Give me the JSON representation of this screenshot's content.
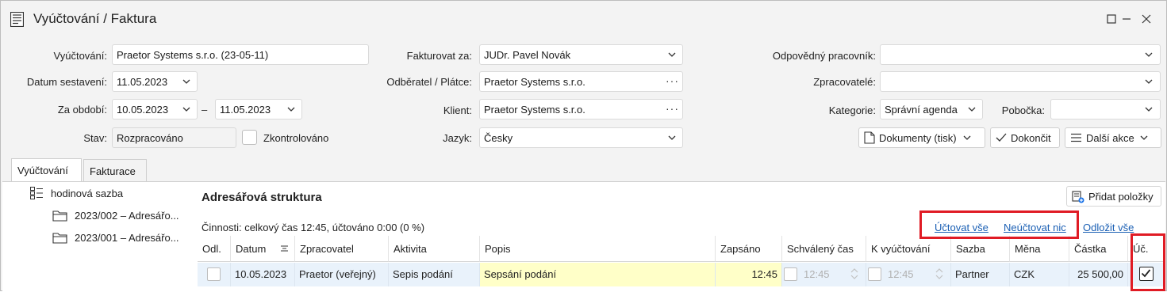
{
  "window": {
    "title": "Vyúčtování / Faktura",
    "controls": [
      "minimize-icon",
      "maximize-icon",
      "close-icon"
    ]
  },
  "form": {
    "vyuctovani_label": "Vyúčtování:",
    "vyuctovani_value": "Praetor Systems s.r.o. (23-05-11)",
    "datum_sestaveni_label": "Datum sestavení:",
    "datum_sestaveni_value": "11.05.2023",
    "za_obdobi_label": "Za období:",
    "za_obdobi_from": "10.05.2023",
    "za_obdobi_sep": "–",
    "za_obdobi_to": "11.05.2023",
    "stav_label": "Stav:",
    "stav_value": "Rozpracováno",
    "zkontrolovano_label": "Zkontrolováno",
    "fakturovat_za_label": "Fakturovat za:",
    "fakturovat_za_value": "JUDr. Pavel Novák",
    "odberatel_label": "Odběratel / Plátce:",
    "odberatel_value": "Praetor Systems s.r.o.",
    "klient_label": "Klient:",
    "klient_value": "Praetor Systems s.r.o.",
    "jazyk_label": "Jazyk:",
    "jazyk_value": "Česky",
    "odpovedny_label": "Odpovědný pracovník:",
    "odpovedny_value": "",
    "zpracovatele_label": "Zpracovatelé:",
    "zpracovatele_value": "",
    "kategorie_label": "Kategorie:",
    "kategorie_value": "Správní agenda",
    "pobocka_label": "Pobočka:",
    "pobocka_value": ""
  },
  "actions": {
    "dokumenty": "Dokumenty (tisk)",
    "dokoncit": "Dokončit",
    "dalsi_akce": "Další akce"
  },
  "tabs": [
    "Vyúčtování",
    "Fakturace"
  ],
  "tree": {
    "root": "hodinová sazba",
    "children": [
      "2023/002 – Adresářo...",
      "2023/001 – Adresářo..."
    ]
  },
  "section": {
    "title": "Adresářová struktura",
    "add_button": "Přidat položky",
    "summary": "Činnosti: celkový čas 12:45, účtováno 0:00 (0 %)",
    "links": [
      "Účtovat vše",
      "Neúčtovat nic",
      "Odložit vše"
    ]
  },
  "table": {
    "columns": [
      "Odl.",
      "Datum",
      "Zpracovatel",
      "Aktivita",
      "Popis",
      "Zapsáno",
      "Schválený čas",
      "K vyúčtování",
      "Sazba",
      "Měna",
      "Částka",
      "Úč."
    ],
    "rows": [
      {
        "odl": false,
        "datum": "10.05.2023",
        "zpracovatel": "Praetor (veřejný)",
        "aktivita": "Sepis podání",
        "popis": "Sepsání podání",
        "zapsano": "12:45",
        "schvaleny_cas": "12:45",
        "k_vyuctovani": "12:45",
        "sazba": "Partner",
        "mena": "CZK",
        "castka": "25 500,00",
        "uct": true
      }
    ]
  },
  "colors": {
    "highlight_red": "#e01b24",
    "link_blue": "#1a5fb4",
    "row_yellow": "#ffffc8",
    "row_blue": "#e9f2fb"
  }
}
